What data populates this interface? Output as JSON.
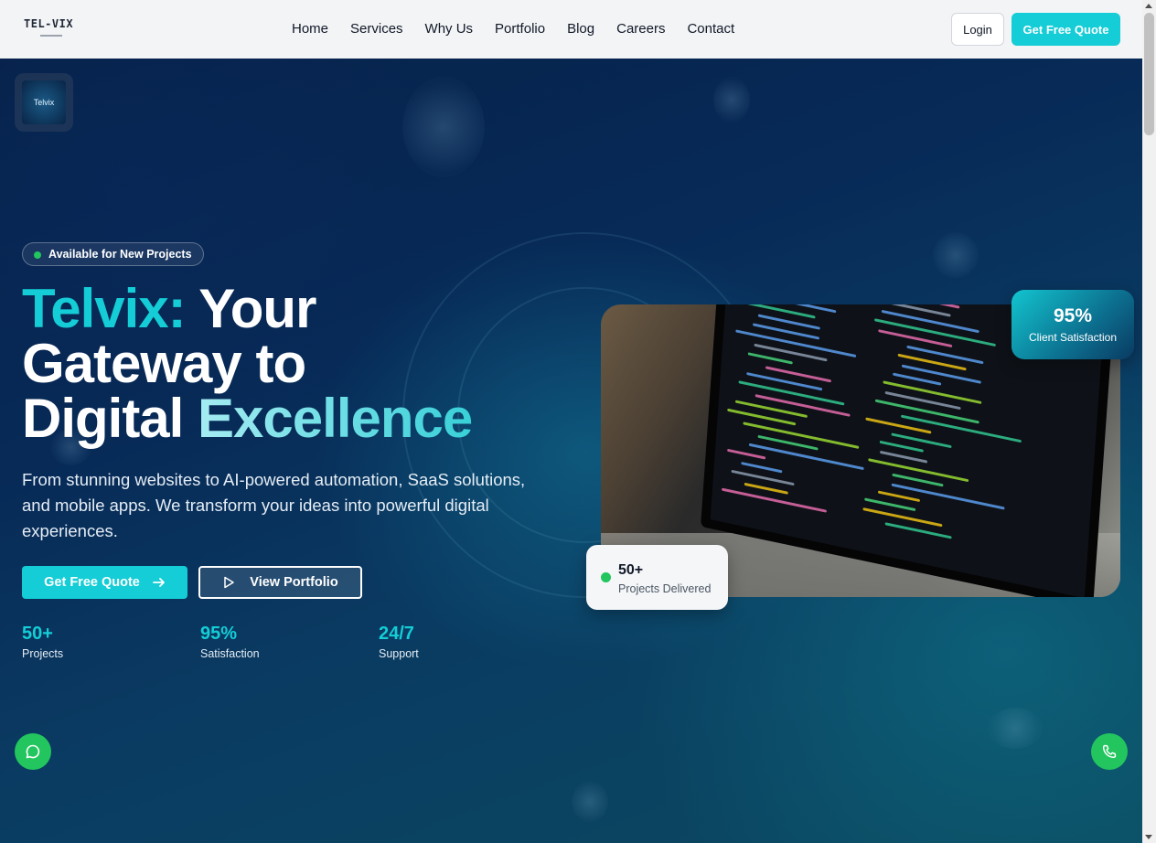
{
  "brand": {
    "logo_text": "TEL-VIX"
  },
  "nav": {
    "items": [
      {
        "label": "Home"
      },
      {
        "label": "Services"
      },
      {
        "label": "Why Us"
      },
      {
        "label": "Portfolio"
      },
      {
        "label": "Blog"
      },
      {
        "label": "Careers"
      },
      {
        "label": "Contact"
      }
    ],
    "login_label": "Login",
    "quote_label": "Get Free Quote"
  },
  "hero": {
    "corner_badge_text": "Telvix",
    "availability": "Available for New Projects",
    "title_brand": "Telvix:",
    "title_part1": " Your",
    "title_part2": "Gateway to",
    "title_part3": "Digital ",
    "title_highlight": "Excellence",
    "subtitle": "From stunning websites to AI-powered automation, SaaS solutions, and mobile apps. We transform your ideas into powerful digital experiences.",
    "cta_primary": "Get Free Quote",
    "cta_secondary": "View Portfolio",
    "stats": [
      {
        "value": "50+",
        "label": "Projects"
      },
      {
        "value": "95%",
        "label": "Satisfaction"
      },
      {
        "value": "24/7",
        "label": "Support"
      }
    ],
    "card_satisfaction": {
      "value": "95%",
      "label": "Client Satisfaction"
    },
    "card_projects": {
      "value": "50+",
      "label": "Projects Delivered"
    }
  },
  "colors": {
    "accent": "#14cdd6",
    "success": "#22c55e",
    "hero_bg": "#072a57"
  },
  "icons": [
    "arrow-right-icon",
    "play-icon",
    "chat-icon",
    "phone-icon"
  ]
}
